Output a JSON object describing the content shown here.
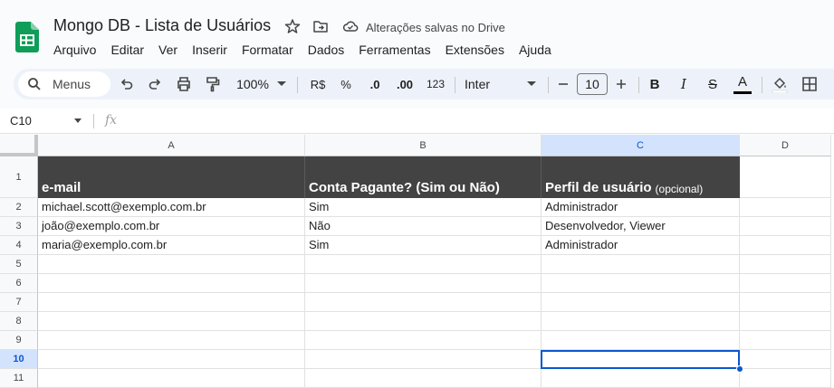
{
  "app": {
    "doc_title": "Mongo DB - Lista de Usuários",
    "saved_status": "Alterações salvas no Drive",
    "menu": [
      "Arquivo",
      "Editar",
      "Ver",
      "Inserir",
      "Formatar",
      "Dados",
      "Ferramentas",
      "Extensões",
      "Ajuda"
    ]
  },
  "toolbar": {
    "search_label": "Menus",
    "zoom": "100%",
    "currency": "R$",
    "percent": "%",
    "decrease_decimal": ".0",
    "increase_decimal": ".00",
    "number_format": "123",
    "font": "Inter",
    "font_size": "10",
    "bold": "B",
    "italic": "I",
    "strikethrough": "S",
    "text_color_letter": "A",
    "accent_color": "#0b57d0"
  },
  "formula_bar": {
    "cell_ref": "C10",
    "fx": "fx",
    "value": ""
  },
  "sheet": {
    "columns": [
      "A",
      "B",
      "C",
      "D"
    ],
    "selected_column": "C",
    "selected_row": "10",
    "header": {
      "a": "e-mail",
      "b": "Conta Pagante? (Sim ou Não)",
      "c": "Perfil de usuário",
      "c_note": "(opcional)"
    },
    "rows": [
      {
        "num": "1"
      },
      {
        "num": "2",
        "a": "michael.scott@exemplo.com.br",
        "b": "Sim",
        "c": "Administrador"
      },
      {
        "num": "3",
        "a": "joão@exemplo.com.br",
        "b": "Não",
        "c": "Desenvolvedor, Viewer"
      },
      {
        "num": "4",
        "a": "maria@exemplo.com.br",
        "b": "Sim",
        "c": "Administrador"
      },
      {
        "num": "5"
      },
      {
        "num": "6"
      },
      {
        "num": "7"
      },
      {
        "num": "8"
      },
      {
        "num": "9"
      },
      {
        "num": "10"
      },
      {
        "num": "11"
      }
    ]
  }
}
